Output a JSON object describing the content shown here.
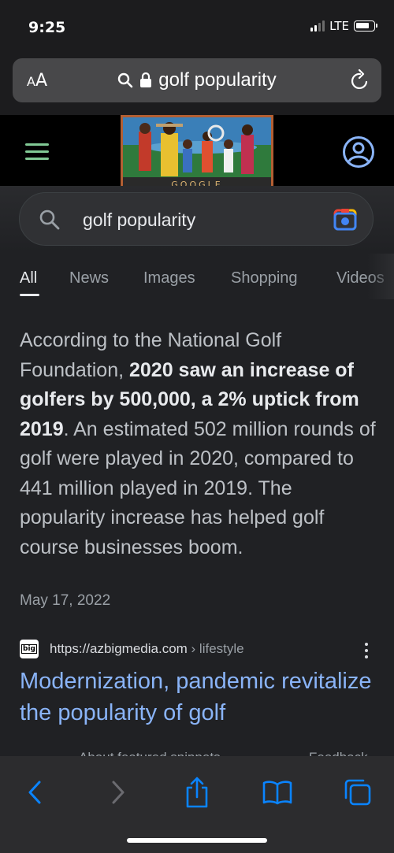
{
  "status_bar": {
    "time": "9:25",
    "network": "LTE",
    "signal_bars": 2,
    "signal_total": 4
  },
  "address_bar": {
    "text_size_label": "AA",
    "url_text": "golf popularity"
  },
  "google": {
    "doodle_label": "GOOGLE"
  },
  "search": {
    "query": "golf popularity"
  },
  "tabs": [
    {
      "label": "All",
      "active": true
    },
    {
      "label": "News",
      "active": false
    },
    {
      "label": "Images",
      "active": false
    },
    {
      "label": "Shopping",
      "active": false
    },
    {
      "label": "Videos",
      "active": false
    }
  ],
  "snippet": {
    "part1": "According to the National Golf Foundation, ",
    "bold": "2020 saw an increase of golfers by 500,000, a 2% uptick from 2019",
    "part2": ". An estimated 502 million rounds of golf were played in 2020, compared to 441 million played in 2019. The popularity increase has helped golf course businesses boom.",
    "date": "May 17, 2022"
  },
  "source": {
    "favicon_text": "big",
    "url": "https://azbigmedia.com",
    "breadcrumb": " › lifestyle",
    "title": "Modernization, pandemic revitalize the popularity of golf"
  },
  "footer_links": {
    "about": "About featured snippets",
    "feedback": "Feedback"
  },
  "toolbar": {
    "back": "chevron-left-icon",
    "forward": "chevron-right-icon",
    "share": "share-icon",
    "bookmarks": "book-icon",
    "tabs": "tabs-icon"
  },
  "colors": {
    "link": "#8ab4f8",
    "toolbar_accent": "#0a84ff",
    "menu_green": "#81c995"
  }
}
